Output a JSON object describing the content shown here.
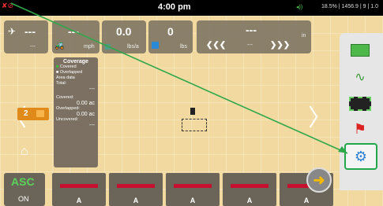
{
  "topbar": {
    "time": "4:00 pm",
    "status": "18.5% | 1456.9 | 9 | 1.0"
  },
  "tiles": {
    "gps": {
      "value": "---",
      "sub": "---"
    },
    "speed": {
      "value": "---",
      "unit": "mph"
    },
    "rate": {
      "value": "0.0",
      "unit": "lbs/a"
    },
    "tank": {
      "value": "0",
      "unit": "lbs"
    },
    "guidance": {
      "value": "---",
      "unit": "in",
      "offset": "---"
    }
  },
  "coverage": {
    "title": "Coverage",
    "legend": [
      "Covered",
      "Overlapped"
    ],
    "area_label": "Area data",
    "total_label": "Total:",
    "total_value": "---",
    "covered_label": "Covered:",
    "covered_value": "0.00 ac",
    "overlapped_label": "Overlapped:",
    "overlapped_value": "0.00 ac",
    "uncovered_label": "Uncovered:",
    "uncovered_value": "---"
  },
  "left_panel": {
    "camera_number": "2"
  },
  "asc": {
    "label": "ASC",
    "state": "ON"
  },
  "sections": [
    "A",
    "A",
    "A",
    "A",
    "A"
  ],
  "right_toolbar": {
    "items": [
      "map-icon",
      "guidance-icon",
      "field-icon",
      "flag-icon",
      "gear-icon"
    ],
    "highlighted": "gear-icon"
  },
  "colors": {
    "field": "#f1d9a0",
    "panel": "#787060",
    "section_bar": "#c8102e",
    "highlight": "#22a84a"
  }
}
